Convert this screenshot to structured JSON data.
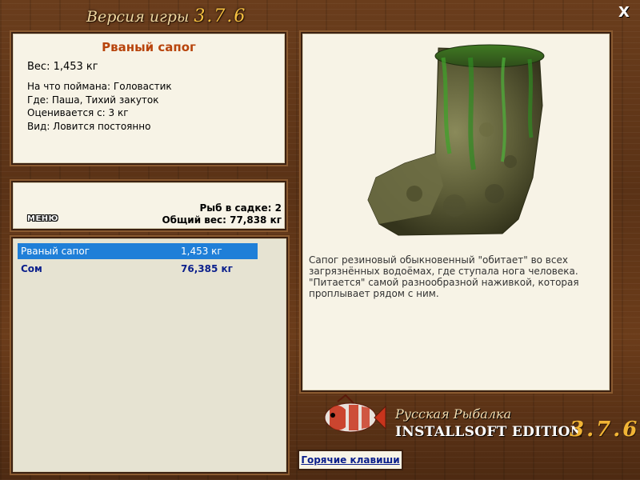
{
  "window": {
    "title": "Версия игры",
    "version": "3.7.6",
    "close_label": "X"
  },
  "catch": {
    "name": "Рваный сапог",
    "weight_line": "Вес: 1,453 кг",
    "caught_on_line": "На что поймана: Головастик",
    "where_line": "Где: Паша, Тихий закуток",
    "valued_from_line": "Оценивается с: 3 кг",
    "kind_line": "Вид: Ловится постоянно"
  },
  "summary": {
    "menu_label": "МЕНЮ",
    "fish_count_line": "Рыб в садке: 2",
    "total_weight_line": "Общий вес: 77,838 кг"
  },
  "keepnet": {
    "rows": [
      {
        "name": "Рваный сапог",
        "weight": "1,453 кг",
        "selected": true
      },
      {
        "name": "Сом",
        "weight": "76,385 кг",
        "selected": false
      }
    ]
  },
  "details": {
    "description": "Сапог резиновый обыкновенный \"обитает\" во всех загрязнённых водоёмах, где ступала нога человека. \"Питается\" самой разнообразной наживкой, которая проплывает рядом с ним.",
    "image_icon": "boot-image"
  },
  "brand": {
    "line1": "Русская Рыбалка",
    "line2": "INSTALLSOFT EDITION",
    "version": "3.7.6",
    "logo_icon": "fish-logo-icon"
  },
  "hotkeys_label": "Горячие клавиши",
  "colors": {
    "accent_name": "#b8440c",
    "selection": "#1f7fd8",
    "list_text": "#0b1f8c",
    "version_gold": "#f2b535"
  }
}
